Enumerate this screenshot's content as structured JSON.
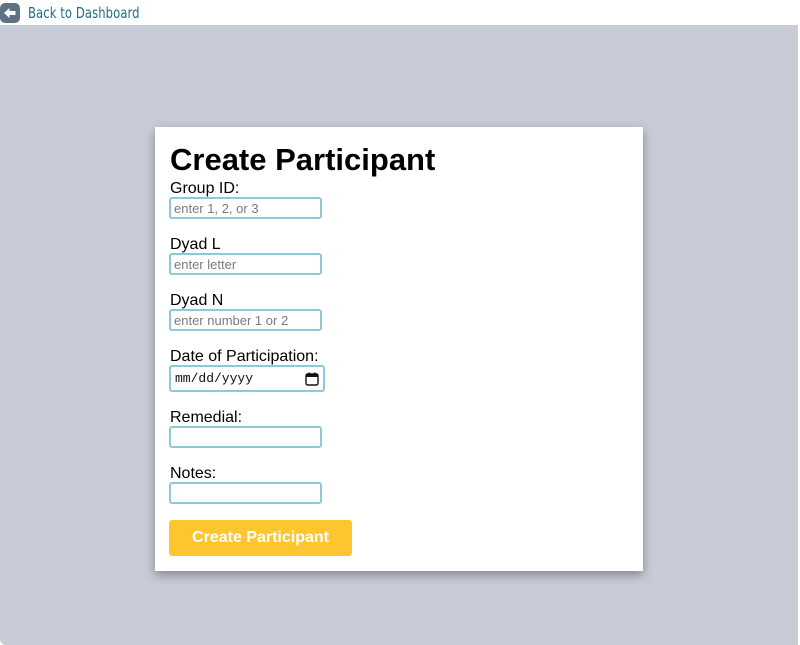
{
  "nav": {
    "back_label": "Back to Dashboard",
    "back_icon": "arrow-left-circle-icon"
  },
  "form": {
    "title": "Create Participant",
    "group_id": {
      "label": "Group ID:",
      "placeholder": "enter 1, 2, or 3",
      "value": ""
    },
    "dyad_l": {
      "label": "Dyad L",
      "placeholder": "enter letter",
      "value": ""
    },
    "dyad_n": {
      "label": "Dyad N",
      "placeholder": "enter number 1 or 2",
      "value": ""
    },
    "date": {
      "label": "Date of Participation:",
      "display": "mm/dd/yyyy",
      "icon": "calendar-icon"
    },
    "remedial": {
      "label": "Remedial:",
      "value": ""
    },
    "notes": {
      "label": "Notes:",
      "value": ""
    },
    "submit_label": "Create Participant"
  },
  "colors": {
    "page_background": "#c8ccd6",
    "link": "#1f6f85",
    "input_border": "#8fc9d9",
    "button": "#fdc52f",
    "button_text": "#ffffff"
  }
}
